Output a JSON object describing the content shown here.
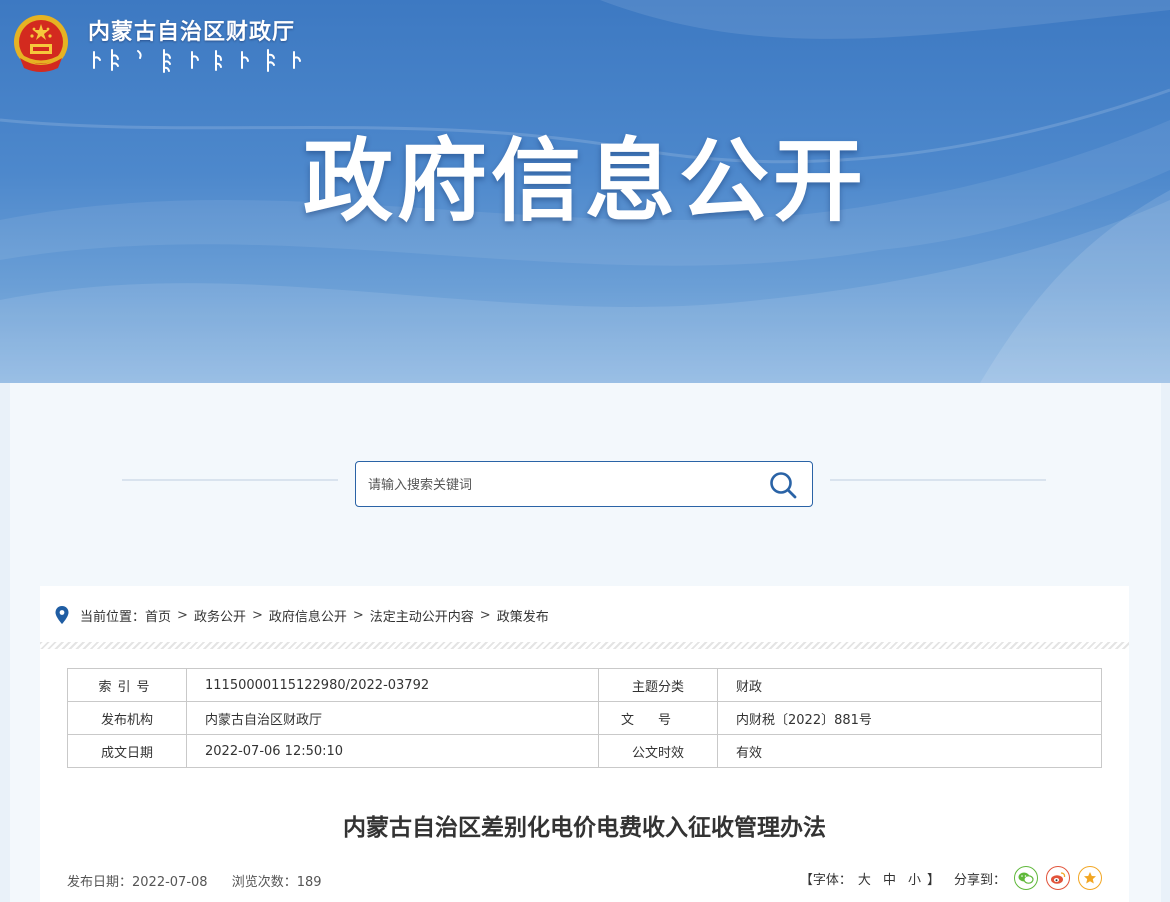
{
  "header": {
    "org_name": "内蒙古自治区财政厅",
    "banner_title": "政府信息公开"
  },
  "search": {
    "placeholder": "请输入搜索关键词"
  },
  "breadcrumb": {
    "prefix": "当前位置：",
    "items": [
      "首页",
      "政务公开",
      "政府信息公开",
      "法定主动公开内容",
      "政策发布"
    ],
    "separator": ">"
  },
  "meta_table": {
    "rows": [
      {
        "k1": "索引号",
        "v1": "11150000115122980/2022-03792",
        "k2": "主题分类",
        "v2": "财政"
      },
      {
        "k1": "发布机构",
        "v1": "内蒙古自治区财政厅",
        "k2": "文号",
        "v2": "内财税〔2022〕881号"
      },
      {
        "k1": "成文日期",
        "v1": "2022-07-06 12:50:10",
        "k2": "公文时效",
        "v2": "有效"
      }
    ]
  },
  "document": {
    "title": "内蒙古自治区差别化电价电费收入征收管理办法",
    "publish_date": "发布日期：2022-07-08",
    "views": "浏览次数：189"
  },
  "tools": {
    "font_label_open": "【字体：",
    "font_large": "大",
    "font_medium": "中",
    "font_small": "小",
    "font_label_close": "】",
    "share_label": "分享到："
  },
  "colors": {
    "banner": "#4d88cc",
    "search_border": "#2a63a6",
    "wechat": "#5fb83a",
    "weibo": "#e2533a",
    "favorite": "#f2a623"
  },
  "icons": [
    "national-emblem-icon",
    "search-icon",
    "location-pin-icon",
    "wechat-icon",
    "weibo-icon",
    "favorite-icon"
  ]
}
